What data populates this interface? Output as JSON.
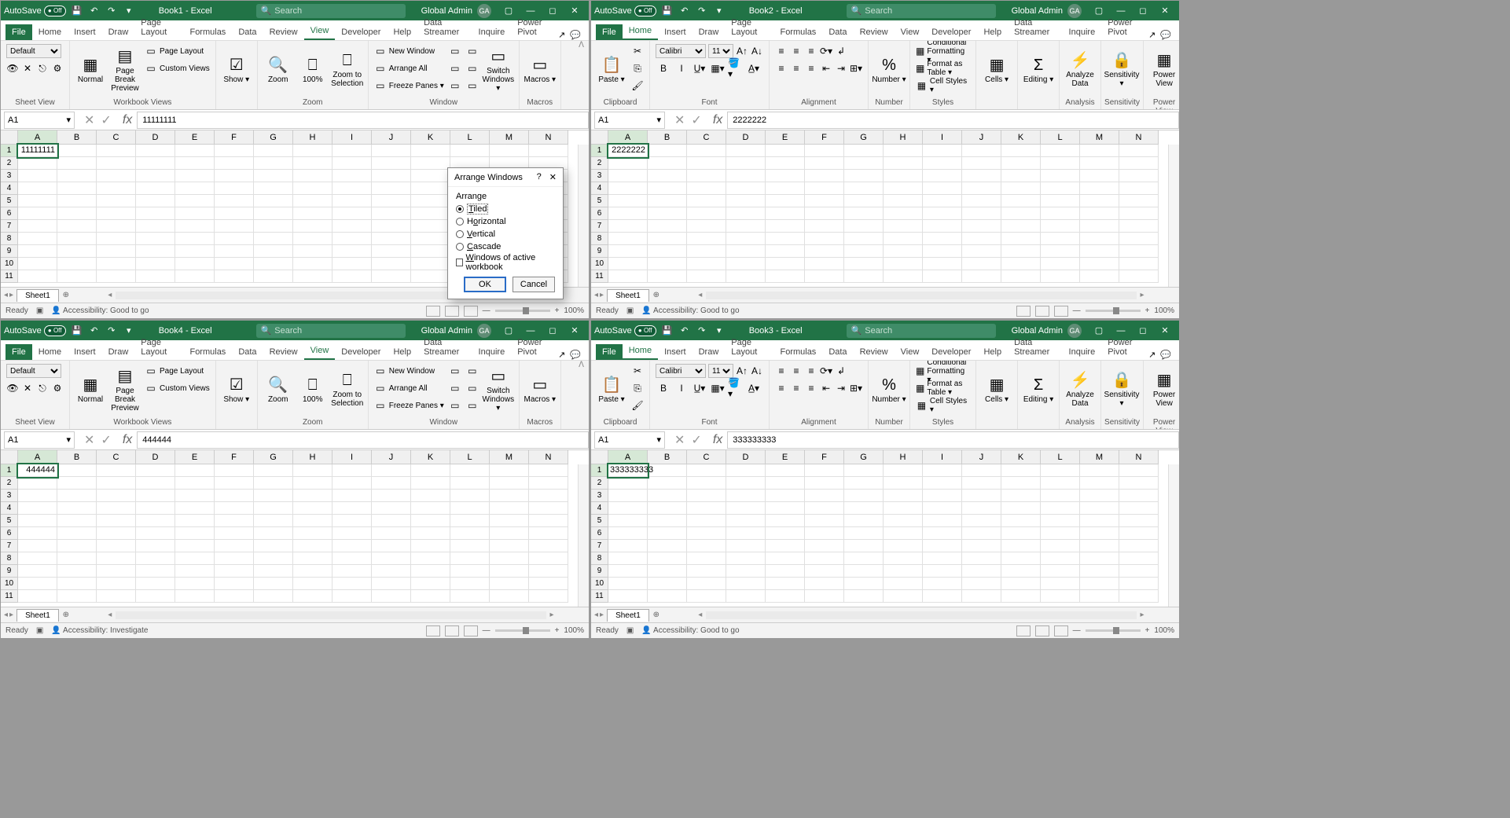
{
  "autosave_label": "AutoSave",
  "autosave_state": "Off",
  "search_placeholder": "Search",
  "user_name": "Global Admin",
  "user_initials": "GA",
  "tabs_list": [
    "File",
    "Home",
    "Insert",
    "Draw",
    "Page Layout",
    "Formulas",
    "Data",
    "Review",
    "View",
    "Developer",
    "Help",
    "Data Streamer",
    "Inquire",
    "Power Pivot"
  ],
  "windows": [
    {
      "title": "Book1  -  Excel",
      "active_tab": "View",
      "cell_ref": "A1",
      "formula": "11111111",
      "a1": "11111111",
      "a1_align": "right",
      "status": "Ready",
      "accessibility": "Accessibility: Good to go",
      "zoom": "100%",
      "ribbon": "view",
      "sheet": "Sheet1"
    },
    {
      "title": "Book2  -  Excel",
      "active_tab": "Home",
      "cell_ref": "A1",
      "formula": "2222222",
      "a1": "2222222",
      "a1_align": "right",
      "status": "Ready",
      "accessibility": "Accessibility: Good to go",
      "zoom": "100%",
      "ribbon": "home",
      "sheet": "Sheet1"
    },
    {
      "title": "Book4  -  Excel",
      "active_tab": "View",
      "cell_ref": "A1",
      "formula": "444444",
      "a1": "444444",
      "a1_align": "right",
      "status": "Ready",
      "accessibility": "Accessibility: Investigate",
      "zoom": "100%",
      "ribbon": "view",
      "sheet": "Sheet1"
    },
    {
      "title": "Book3  -  Excel",
      "active_tab": "Home",
      "cell_ref": "A1",
      "formula": "333333333",
      "a1": "333333333",
      "a1_align": "right",
      "status": "Ready",
      "accessibility": "Accessibility: Good to go",
      "zoom": "100%",
      "ribbon": "home",
      "sheet": "Sheet1"
    }
  ],
  "view_ribbon": {
    "sheet_view_default": "Default",
    "sheet_view_group": "Sheet View",
    "normal": "Normal",
    "page_break": "Page Break Preview",
    "page_layout": "Page Layout",
    "custom_views": "Custom Views",
    "workbook_views_group": "Workbook Views",
    "show": "Show",
    "zoom": "Zoom",
    "pct100": "100%",
    "zoom_to_sel": "Zoom to Selection",
    "zoom_group": "Zoom",
    "new_window": "New Window",
    "arrange_all": "Arrange All",
    "freeze_panes": "Freeze Panes",
    "switch_windows": "Switch Windows",
    "window_group": "Window",
    "macros": "Macros",
    "macros_group": "Macros"
  },
  "home_ribbon": {
    "paste": "Paste",
    "clipboard_group": "Clipboard",
    "font_name": "Calibri",
    "font_size": "11",
    "font_group": "Font",
    "alignment_group": "Alignment",
    "number": "Number",
    "number_group": "Number",
    "cond_fmt": "Conditional Formatting",
    "fmt_table": "Format as Table",
    "cell_styles": "Cell Styles",
    "styles_group": "Styles",
    "cells": "Cells",
    "editing": "Editing",
    "analyze": "Analyze Data",
    "analysis_group": "Analysis",
    "sensitivity": "Sensitivity",
    "sensitivity_group": "Sensitivity",
    "power_view": "Power View",
    "power_view_group": "Power View"
  },
  "columns": [
    "A",
    "B",
    "C",
    "D",
    "E",
    "F",
    "G",
    "H",
    "I",
    "J",
    "K",
    "L",
    "M",
    "N"
  ],
  "dialog": {
    "title": "Arrange Windows",
    "fieldset": "Arrange",
    "tiled": "Tiled",
    "horizontal": "Horizontal",
    "vertical": "Vertical",
    "cascade": "Cascade",
    "active_wb": "Windows of active workbook",
    "ok": "OK",
    "cancel": "Cancel"
  }
}
